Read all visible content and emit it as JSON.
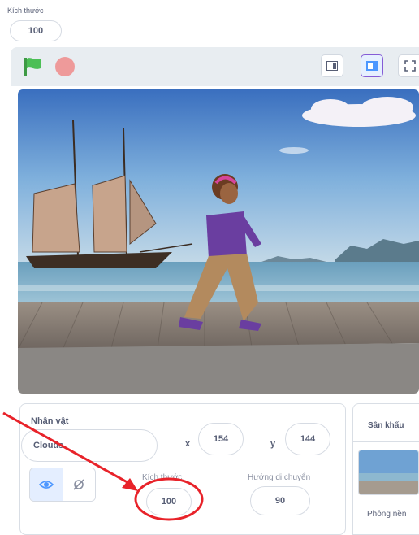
{
  "top": {
    "size_label": "Kích thước",
    "size_value": "100"
  },
  "stage_header": {
    "green_flag": "green-flag-icon",
    "stop": "stop-icon",
    "small_stage": "small-stage-icon",
    "normal_stage": "normal-stage-icon",
    "fullscreen": "fullscreen-icon"
  },
  "sprite_panel": {
    "title": "Nhân vật",
    "name_value": "Clouds",
    "x_label": "x",
    "x_value": "154",
    "y_label": "y",
    "y_value": "144",
    "size_label": "Kích thước",
    "size_value": "100",
    "direction_label": "Hướng di chuyển",
    "direction_value": "90"
  },
  "stage_panel": {
    "title": "Sân khấu",
    "backdrop_caption": "Phông nền"
  },
  "colors": {
    "accent": "#855cd6",
    "blue": "#4c97ff",
    "annotation": "#e8232a",
    "flag": "#4cbf56",
    "stop": "#ee9a9a"
  }
}
